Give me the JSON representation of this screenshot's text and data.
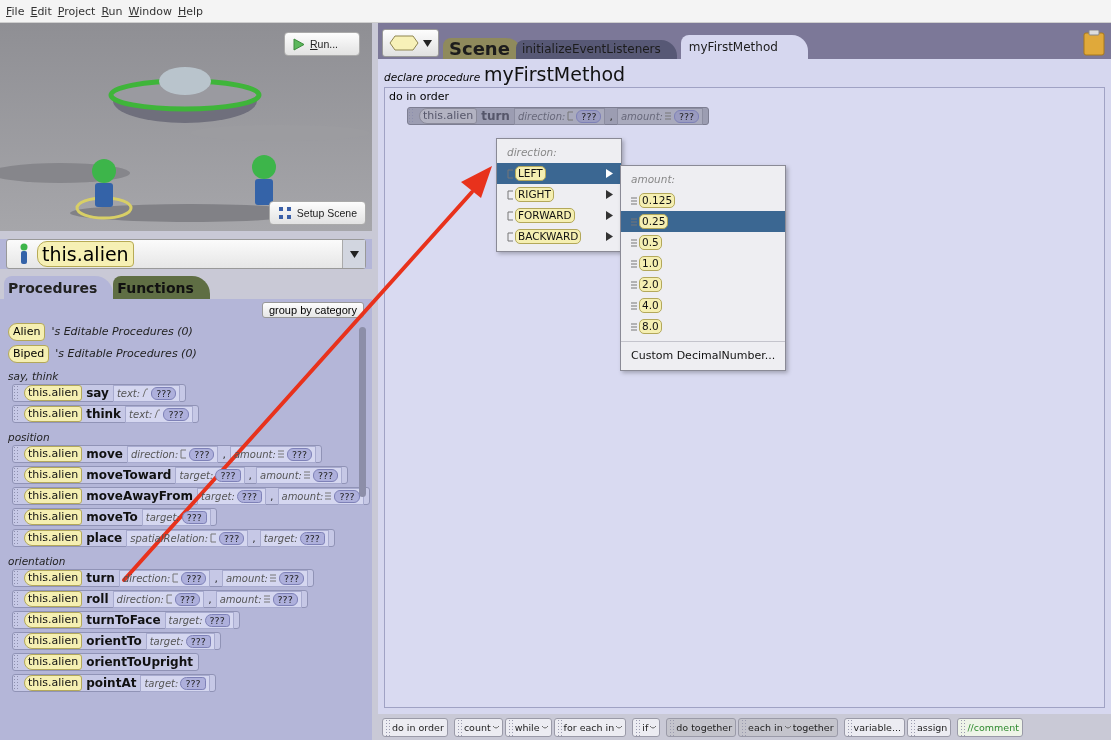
{
  "menu_bar": [
    "File",
    "Edit",
    "Project",
    "Run",
    "Window",
    "Help"
  ],
  "scene": {
    "kind": "picture",
    "run_button": "Run...",
    "setup_button": "Setup Scene"
  },
  "object_selector": "this.alien",
  "member_tabs": [
    {
      "label": "Procedures",
      "selected": true
    },
    {
      "label": "Functions",
      "selected": false
    }
  ],
  "group_button": "group by category",
  "editable_procedures": [
    {
      "type": "Alien",
      "text": "'s Editable Procedures (0)"
    },
    {
      "type": "Biped",
      "text": "'s Editable Procedures (0)"
    }
  ],
  "categories": [
    {
      "name": "say, think",
      "procedures": [
        {
          "target": "this.alien",
          "name": "say",
          "params": [
            {
              "label": "text:",
              "kind": "text",
              "value": "???"
            }
          ]
        },
        {
          "target": "this.alien",
          "name": "think",
          "params": [
            {
              "label": "text:",
              "kind": "text",
              "value": "???"
            }
          ]
        }
      ]
    },
    {
      "name": "position",
      "procedures": [
        {
          "target": "this.alien",
          "name": "move",
          "params": [
            {
              "label": "direction:",
              "kind": "direction",
              "value": "???"
            },
            {
              "lead": ",",
              "label": "amount:",
              "kind": "number",
              "value": "???"
            }
          ]
        },
        {
          "target": "this.alien",
          "name": "moveToward",
          "params": [
            {
              "label": "target:",
              "kind": "object",
              "value": "???"
            },
            {
              "lead": ",",
              "label": "amount:",
              "kind": "number",
              "value": "???"
            }
          ]
        },
        {
          "target": "this.alien",
          "name": "moveAwayFrom",
          "params": [
            {
              "label": "target:",
              "kind": "object",
              "value": "???"
            },
            {
              "lead": ",",
              "label": "amount:",
              "kind": "number",
              "value": "???"
            }
          ]
        },
        {
          "target": "this.alien",
          "name": "moveTo",
          "params": [
            {
              "label": "target:",
              "kind": "object",
              "value": "???"
            }
          ]
        },
        {
          "target": "this.alien",
          "name": "place",
          "params": [
            {
              "label": "spatialRelation:",
              "kind": "direction",
              "value": "???"
            },
            {
              "lead": ",",
              "label": "target:",
              "kind": "object",
              "value": "???"
            }
          ]
        }
      ]
    },
    {
      "name": "orientation",
      "procedures": [
        {
          "target": "this.alien",
          "name": "turn",
          "params": [
            {
              "label": "direction:",
              "kind": "direction",
              "value": "???"
            },
            {
              "lead": ",",
              "label": "amount:",
              "kind": "number",
              "value": "???"
            }
          ]
        },
        {
          "target": "this.alien",
          "name": "roll",
          "params": [
            {
              "label": "direction:",
              "kind": "direction",
              "value": "???"
            },
            {
              "lead": ",",
              "label": "amount:",
              "kind": "number",
              "value": "???"
            }
          ]
        },
        {
          "target": "this.alien",
          "name": "turnToFace",
          "params": [
            {
              "label": "target:",
              "kind": "object",
              "value": "???"
            }
          ]
        },
        {
          "target": "this.alien",
          "name": "orientTo",
          "params": [
            {
              "label": "target:",
              "kind": "object",
              "value": "???"
            }
          ]
        },
        {
          "target": "this.alien",
          "name": "orientToUpright"
        },
        {
          "target": "this.alien",
          "name": "pointAt",
          "params": [
            {
              "label": "target:",
              "kind": "object",
              "value": "???"
            }
          ]
        }
      ]
    }
  ],
  "code_tabs": [
    {
      "label": "Scene",
      "kind": "scene",
      "selected": false
    },
    {
      "label": "initializeEventListeners",
      "kind": "method",
      "selected": false
    },
    {
      "label": "myFirstMethod",
      "kind": "method",
      "selected": true
    }
  ],
  "declare_label": "declare procedure",
  "method_name": "myFirstMethod",
  "body_label": "do in order",
  "statement": {
    "target": "this.alien",
    "name": "turn",
    "ghost": true,
    "params": [
      {
        "label": "direction:",
        "kind": "direction",
        "value": "???"
      },
      {
        "lead": ",",
        "label": "amount:",
        "kind": "number",
        "value": "???"
      }
    ]
  },
  "direction_menu": {
    "title": "direction:",
    "items": [
      {
        "label": "LEFT",
        "selected": true
      },
      {
        "label": "RIGHT",
        "selected": false
      },
      {
        "label": "FORWARD",
        "selected": false
      },
      {
        "label": "BACKWARD",
        "selected": false
      }
    ]
  },
  "amount_menu": {
    "title": "amount:",
    "items": [
      {
        "label": "0.125",
        "selected": false
      },
      {
        "label": "0.25",
        "selected": true
      },
      {
        "label": "0.5",
        "selected": false
      },
      {
        "label": "1.0",
        "selected": false
      },
      {
        "label": "2.0",
        "selected": false
      },
      {
        "label": "4.0",
        "selected": false
      },
      {
        "label": "8.0",
        "selected": false
      }
    ],
    "custom": "Custom DecimalNumber..."
  },
  "control_bar": [
    [
      {
        "parts": [
          "do in order"
        ],
        "caret": false,
        "kind": "plain"
      }
    ],
    [
      {
        "parts": [
          "count"
        ],
        "caret": true,
        "kind": "plain"
      },
      {
        "parts": [
          "while"
        ],
        "caret": true,
        "kind": "plain"
      },
      {
        "parts": [
          "for each in"
        ],
        "caret": true,
        "kind": "plain"
      }
    ],
    [
      {
        "parts": [
          "if"
        ],
        "caret": true,
        "kind": "plain"
      }
    ],
    [
      {
        "parts": [
          "do together"
        ],
        "caret": false,
        "kind": "together"
      },
      {
        "parts": [
          "each in",
          "together"
        ],
        "caret": true,
        "kind": "together"
      }
    ],
    [
      {
        "parts": [
          "variable..."
        ],
        "caret": false,
        "kind": "plain"
      },
      {
        "parts": [
          "assign"
        ],
        "caret": false,
        "kind": "plain"
      }
    ],
    [
      {
        "parts": [
          "//comment"
        ],
        "caret": false,
        "kind": "comment"
      }
    ]
  ]
}
